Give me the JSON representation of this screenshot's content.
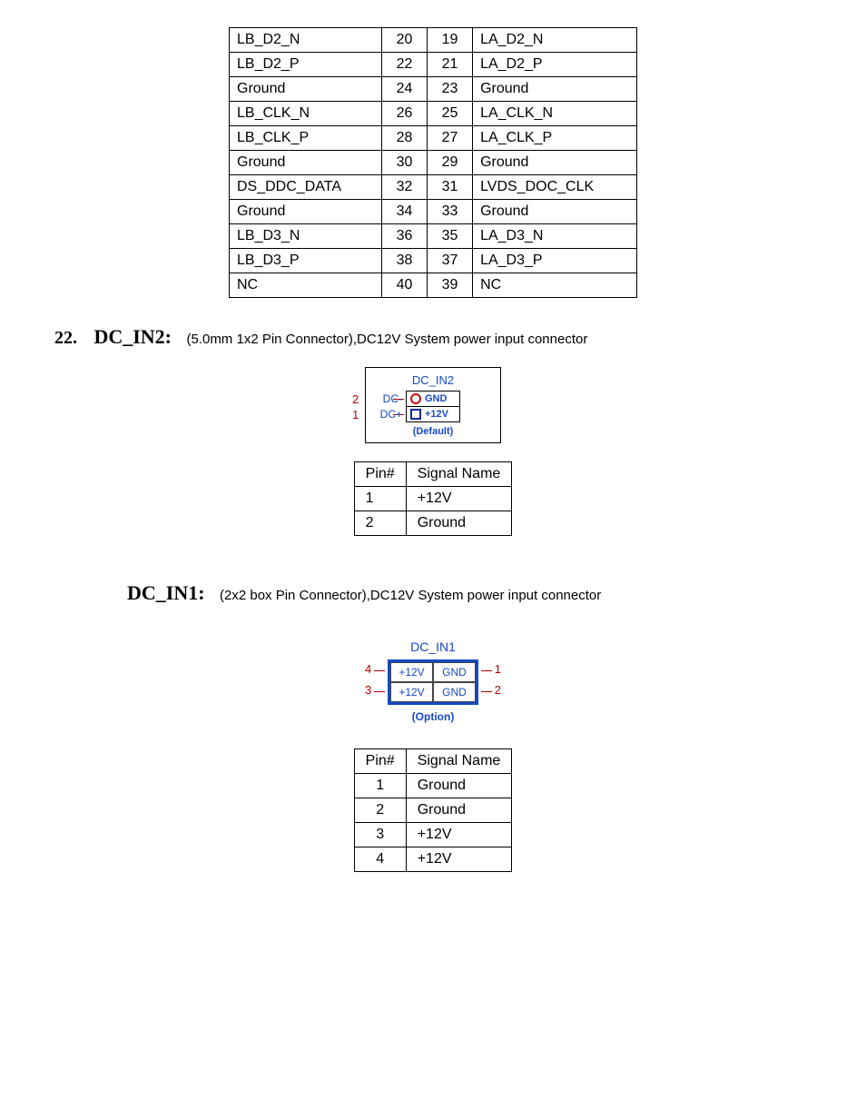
{
  "table1": {
    "rows": [
      {
        "l": "LB_D2_N",
        "ln": "20",
        "rn": "19",
        "r": "LA_D2_N"
      },
      {
        "l": "LB_D2_P",
        "ln": "22",
        "rn": "21",
        "r": "LA_D2_P"
      },
      {
        "l": "Ground",
        "ln": "24",
        "rn": "23",
        "r": "Ground"
      },
      {
        "l": "LB_CLK_N",
        "ln": "26",
        "rn": "25",
        "r": "LA_CLK_N"
      },
      {
        "l": "LB_CLK_P",
        "ln": "28",
        "rn": "27",
        "r": "LA_CLK_P"
      },
      {
        "l": "Ground",
        "ln": "30",
        "rn": "29",
        "r": "Ground"
      },
      {
        "l": "DS_DDC_DATA",
        "ln": "32",
        "rn": "31",
        "r": "LVDS_DOC_CLK"
      },
      {
        "l": "Ground",
        "ln": "34",
        "rn": "33",
        "r": "Ground"
      },
      {
        "l": "LB_D3_N",
        "ln": "36",
        "rn": "35",
        "r": "LA_D3_N"
      },
      {
        "l": "LB_D3_P",
        "ln": "38",
        "rn": "37",
        "r": "LA_D3_P"
      },
      {
        "l": "NC",
        "ln": "40",
        "rn": "39",
        "r": "NC"
      }
    ]
  },
  "section22": {
    "num": "22.",
    "title": "DC_IN2:",
    "desc": "(5.0mm 1x2 Pin Connector),DC12V System power input connector"
  },
  "dc_in2_diagram": {
    "title": "DC_IN2",
    "pin2_label": "DC-",
    "pin2_num": "2",
    "pin2_signal": "GND",
    "pin1_label": "DC+",
    "pin1_num": "1",
    "pin1_signal": "+12V",
    "default": "(Default)"
  },
  "table_dc_in2": {
    "header": {
      "pin": "Pin#",
      "signal": "Signal Name"
    },
    "rows": [
      {
        "pin": "1",
        "signal": "+12V"
      },
      {
        "pin": "2",
        "signal": "Ground"
      }
    ]
  },
  "section_dc_in1": {
    "title": "DC_IN1:",
    "desc": "(2x2 box Pin Connector),DC12V System power input connector"
  },
  "dc_in1_diagram": {
    "title": "DC_IN1",
    "pin4": "4",
    "pin3": "3",
    "pin1": "1",
    "pin2": "2",
    "v12": "+12V",
    "gnd": "GND",
    "option": "(Option)"
  },
  "table_dc_in1": {
    "header": {
      "pin": "Pin#",
      "signal": "Signal Name"
    },
    "rows": [
      {
        "pin": "1",
        "signal": "Ground"
      },
      {
        "pin": "2",
        "signal": "Ground"
      },
      {
        "pin": "3",
        "signal": "+12V"
      },
      {
        "pin": "4",
        "signal": "+12V"
      }
    ]
  }
}
